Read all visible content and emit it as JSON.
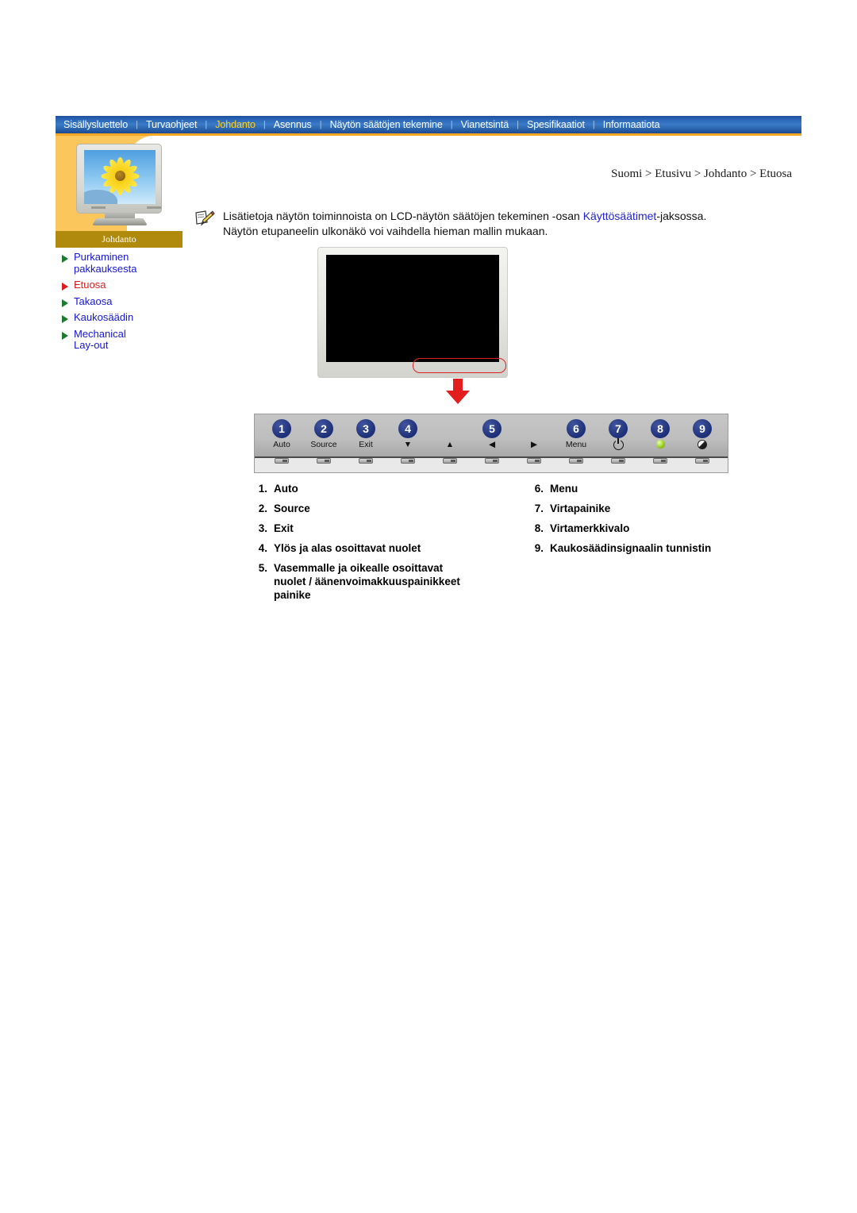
{
  "topnav": {
    "items": [
      {
        "label": "Sisällysluettelo",
        "active": false
      },
      {
        "label": "Turvaohjeet",
        "active": false
      },
      {
        "label": "Johdanto",
        "active": true
      },
      {
        "label": "Asennus",
        "active": false
      },
      {
        "label": "Näytön säätöjen tekemine",
        "active": false
      },
      {
        "label": "Vianetsintä",
        "active": false
      },
      {
        "label": "Spesifikaatiot",
        "active": false
      },
      {
        "label": "Informaatiota",
        "active": false
      }
    ],
    "separator": "|",
    "active_color": "#ffd21e",
    "bar_color": "#3a7bc8",
    "underline_color": "#f5a623"
  },
  "sidebar": {
    "caption": "Johdanto",
    "panel_color": "#fbc65b",
    "caption_bar_color": "#b08a0c",
    "items": [
      {
        "label": "Purkaminen\npakkauksesta",
        "current": false
      },
      {
        "label": "Etuosa",
        "current": true
      },
      {
        "label": "Takaosa",
        "current": false
      },
      {
        "label": "Kaukosäädin",
        "current": false
      },
      {
        "label": "Mechanical\nLay-out",
        "current": false
      }
    ],
    "link_color": "#1515d8",
    "current_color": "#e01b1b",
    "bullet_color": "#1a7a2e"
  },
  "breadcrumb": {
    "text": "Suomi > Etusivu > Johdanto > Etuosa"
  },
  "note": {
    "line1_before": "Lisätietoja näytön toiminnoista on LCD-näytön säätöjen tekeminen -osan ",
    "line1_link": "Käyttösäätimet",
    "line1_after": "-jaksossa.",
    "line2": "Näytön etupaneelin ulkonäkö voi vaihdella hieman mallin mukaan.",
    "link_color": "#2222d6"
  },
  "figure": {
    "highlight_color": "#e02020",
    "arrow_color": "#e31e1e"
  },
  "control_panel": {
    "buttons": [
      {
        "number": "1",
        "label": "Auto",
        "glyph": "text"
      },
      {
        "number": "2",
        "label": "Source",
        "glyph": "text"
      },
      {
        "number": "3",
        "label": "Exit",
        "glyph": "text"
      },
      {
        "number": "4",
        "label": "▼",
        "glyph": "text"
      },
      {
        "number": "",
        "label": "▲",
        "glyph": "text"
      },
      {
        "number": "5",
        "label": "◀",
        "glyph": "text"
      },
      {
        "number": "",
        "label": "▶",
        "glyph": "text"
      },
      {
        "number": "6",
        "label": "Menu",
        "glyph": "text"
      },
      {
        "number": "7",
        "label": "",
        "glyph": "power"
      },
      {
        "number": "8",
        "label": "",
        "glyph": "led"
      },
      {
        "number": "9",
        "label": "",
        "glyph": "ir"
      }
    ],
    "badge_color": "#1c2f77"
  },
  "legend": {
    "left": [
      {
        "index": "1.",
        "text": "Auto"
      },
      {
        "index": "2.",
        "text": "Source"
      },
      {
        "index": "3.",
        "text": "Exit"
      },
      {
        "index": "4.",
        "text": "Ylös ja alas osoittavat nuolet"
      },
      {
        "index": "5.",
        "text": "Vasemmalle ja oikealle osoittavat\nnuolet / äänenvoimakkuuspainikkeet\npainike"
      }
    ],
    "right": [
      {
        "index": "6.",
        "text": "Menu"
      },
      {
        "index": "7.",
        "text": "Virtapainike"
      },
      {
        "index": "8.",
        "text": "Virtamerkkivalo"
      },
      {
        "index": "9.",
        "text": "Kaukosäädinsignaalin tunnistin"
      }
    ]
  }
}
